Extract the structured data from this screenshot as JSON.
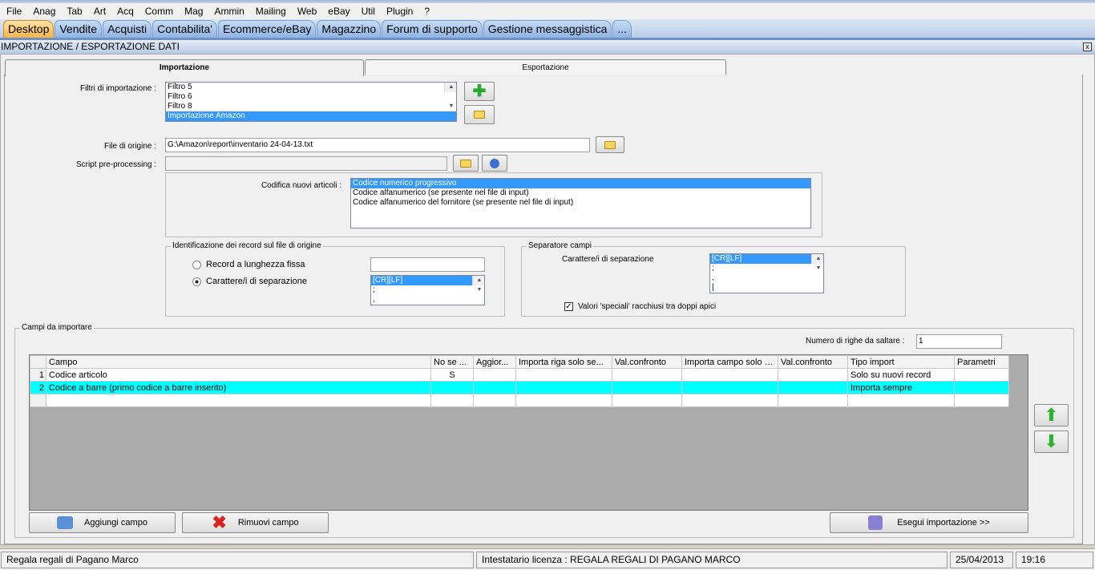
{
  "menu": [
    "File",
    "Anag",
    "Tab",
    "Art",
    "Acq",
    "Comm",
    "Mag",
    "Ammin",
    "Mailing",
    "Web",
    "eBay",
    "Util",
    "Plugin",
    "?"
  ],
  "app_tabs": [
    "Desktop",
    "Vendite",
    "Acquisti",
    "Contabilita'",
    "Ecommerce/eBay",
    "Magazzino",
    "Forum di supporto",
    "Gestione messaggistica",
    "..."
  ],
  "window_title": "IMPORTAZIONE / ESPORTAZIONE DATI",
  "close_label": "x",
  "inner_tabs": {
    "import": "Importazione",
    "export": "Esportazione"
  },
  "filters": {
    "label": "Filtri di importazione :",
    "items": [
      "Filtro 5",
      "Filtro 6",
      "Filtro 8",
      "Importazione Amazon"
    ],
    "selected": "Importazione Amazon"
  },
  "source_file": {
    "label": "File di origine :",
    "value": "G:\\Amazon\\report\\inventario 24-04-13.txt"
  },
  "script": {
    "label": "Script pre-processing :",
    "value": ""
  },
  "codifica": {
    "label": "Codifica nuovi articoli :",
    "items": [
      "Codice numerico progressivo",
      "Codice alfanumerico (se presente nel file di input)",
      "Codice alfanumerico del fornitore (se presente nel file di input)"
    ]
  },
  "record_id": {
    "title": "Identificazione dei record sul file di origine",
    "opt_fixed": "Record a lunghezza fissa",
    "opt_sep": "Carattere/i di separazione",
    "selected": "Carattere/i di separazione",
    "fixed_value": "",
    "sep_items": [
      "[CR][LF]",
      ";",
      ","
    ]
  },
  "field_sep": {
    "title": "Separatore campi",
    "label": "Carattere/i di separazione",
    "items": [
      "[CR][LF]",
      ";",
      ",",
      "|"
    ],
    "quotes_label": "Valori 'speciali' racchiusi tra doppi apici",
    "quotes_checked": true
  },
  "campi": {
    "title": "Campi da importare",
    "skip_label": "Numero di righe da saltare :",
    "skip_value": "1",
    "columns": [
      "Campo",
      "No se ...",
      "Aggior...",
      "Importa riga solo se...",
      "Val.confronto",
      "Importa campo solo s...",
      "Val.confronto",
      "Tipo import",
      "Parametri"
    ],
    "rows": [
      {
        "n": "1",
        "cells": [
          "Codice articolo",
          "S",
          "",
          "",
          "",
          "",
          "",
          "Solo su nuovi record",
          ""
        ]
      },
      {
        "n": "2",
        "cells": [
          "Codice a barre (primo codice a barre inserito)",
          "",
          "",
          "",
          "",
          "",
          "",
          "Importa sempre",
          ""
        ]
      }
    ]
  },
  "buttons": {
    "add": "Aggiungi campo",
    "remove": "Rimuovi campo",
    "run": "Esegui importazione >>"
  },
  "status": {
    "company": "Regala regali di Pagano Marco",
    "license": "Intestatario licenza : REGALA REGALI DI PAGANO MARCO",
    "date": "25/04/2013",
    "time": "19:16"
  }
}
